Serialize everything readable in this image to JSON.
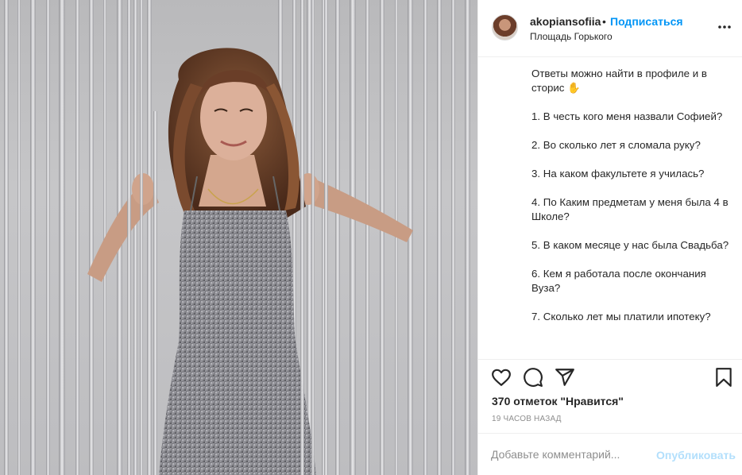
{
  "post": {
    "username": "akopiansofiia",
    "separator": "•",
    "follow_label": "Подписаться",
    "location": "Площадь Горького",
    "caption": [
      "Ответы можно найти в профиле и в сторис ✋",
      "1. В честь кого меня назвали Софией?",
      "2. Во сколько лет я сломала руку?",
      "3. На каком факультете я училась?",
      "4. По Каким предметам у меня была 4 в Школе?",
      "5. В каком месяце у нас была Свадьба?",
      "6. Кем я работала после окончания Вуза?",
      "7. Сколько лет мы платили ипотеку?"
    ],
    "likes": "370 отметок \"Нравится\"",
    "time": "19 ЧАСОВ НАЗАД"
  },
  "comment": {
    "placeholder": "Добавьте комментарий...",
    "publish_label": "Опубликовать"
  },
  "icons": {
    "more": "more-options-icon",
    "like": "heart-icon",
    "comment": "comment-icon",
    "share": "paper-plane-icon",
    "save": "bookmark-icon"
  },
  "colors": {
    "link_blue": "#0095f6",
    "disabled_blue": "#b2dffc",
    "muted": "#8e8e8e",
    "text": "#262626"
  }
}
